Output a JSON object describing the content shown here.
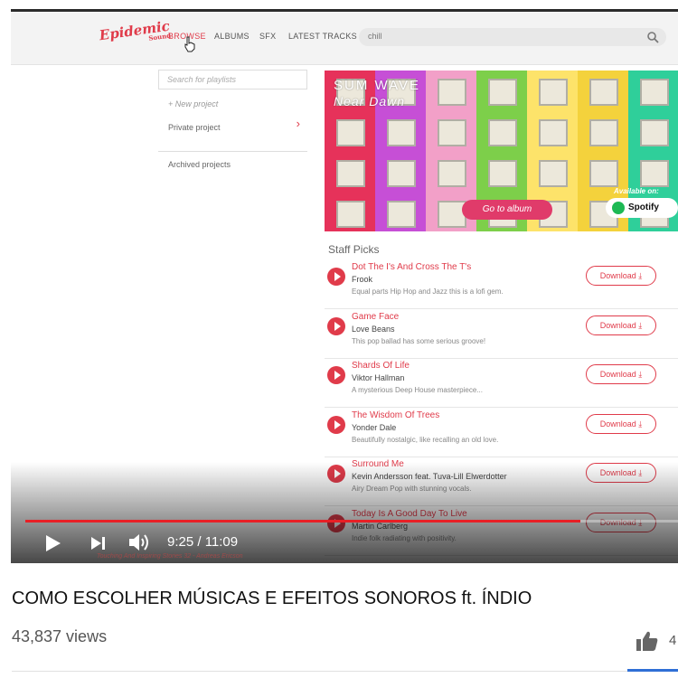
{
  "site": {
    "logo_text": "Epidemic",
    "logo_sub": "Sound",
    "nav": [
      "BROWSE",
      "ALBUMS",
      "SFX",
      "LATEST TRACKS"
    ],
    "search_value": "chill",
    "icons": {
      "search": "search-icon",
      "cursor": "pointer-hand-icon"
    }
  },
  "sidebar": {
    "search_placeholder": "Search for playlists",
    "new_project": "+ New project",
    "private_project": "Private project",
    "chevron": "›",
    "archived": "Archived projects"
  },
  "album": {
    "title": "SUM WAVE",
    "subtitle": "Near Dawn",
    "goto_label": "Go to album",
    "available_label": "Available on:",
    "spotify_label": "Spotify"
  },
  "staff_picks": {
    "heading": "Staff Picks",
    "download_label": "Download",
    "tracks": [
      {
        "name": "Dot The I's And Cross The T's",
        "artist": "Frook",
        "desc": "Equal parts Hip Hop and Jazz this is a lofi gem."
      },
      {
        "name": "Game Face",
        "artist": "Love Beans",
        "desc": "This pop ballad has some serious groove!"
      },
      {
        "name": "Shards Of Life",
        "artist": "Viktor Hallman",
        "desc": "A mysterious Deep House masterpiece..."
      },
      {
        "name": "The Wisdom Of Trees",
        "artist": "Yonder Dale",
        "desc": "Beautifully nostalgic, like recalling an old love."
      },
      {
        "name": "Surround Me",
        "artist": "Kevin Andersson feat. Tuva-Lill Elwerdotter",
        "desc": "Airy Dream Pop with stunning vocals."
      },
      {
        "name": "Today Is A Good Day To Live",
        "artist": "Martin Carlberg",
        "desc": "Indie folk radiating with positivity."
      }
    ]
  },
  "player": {
    "time": "9:25 / 11:09",
    "progress_fraction": 0.85,
    "now_playing": "Touching And Inspiring Stories 32 - Andreas Ericson",
    "icons": {
      "play": "play-icon",
      "next": "skip-next-icon",
      "volume": "volume-icon"
    }
  },
  "video": {
    "title": "COMO ESCOLHER MÚSICAS E EFEITOS SONOROS ft. ÍNDIO",
    "views": "43,837 views",
    "like_count": "4",
    "icons": {
      "like": "thumbs-up-icon"
    }
  },
  "colors": {
    "brand": "#e03b4a",
    "progress": "#e81f25",
    "accent_blue": "#2f6fd6"
  }
}
